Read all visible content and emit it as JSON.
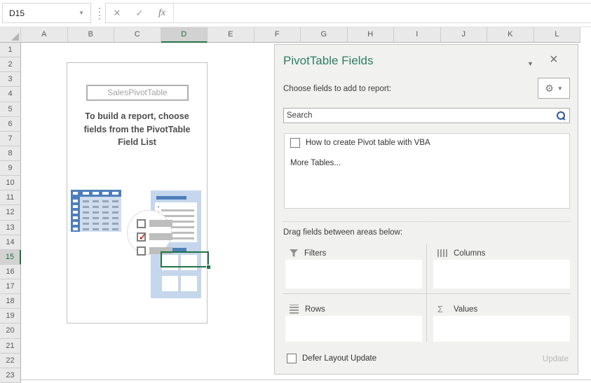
{
  "app": {
    "name_box": "D15",
    "fx_label": "fx"
  },
  "grid": {
    "columns": [
      "A",
      "B",
      "C",
      "D",
      "E",
      "F",
      "G",
      "H",
      "I",
      "J",
      "K",
      "L"
    ],
    "row_count": 23,
    "selected_column": "D",
    "selected_row": 15
  },
  "placeholder": {
    "pivot_name": "SalesPivotTable",
    "message": "To build a report, choose fields from the PivotTable Field List"
  },
  "pane": {
    "title": "PivotTable Fields",
    "subtitle": "Choose fields to add to report:",
    "search": {
      "placeholder": "Search"
    },
    "fields": [
      {
        "label": "How to create Pivot table with VBA",
        "checked": false
      }
    ],
    "more_tables": "More Tables...",
    "drag_hint": "Drag fields between areas below:",
    "areas": [
      {
        "label": "Filters",
        "icon": "funnel-icon"
      },
      {
        "label": "Columns",
        "icon": "columns-icon"
      },
      {
        "label": "Rows",
        "icon": "rows-icon"
      },
      {
        "label": "Values",
        "icon": "sigma-icon"
      }
    ],
    "defer_label": "Defer Layout Update",
    "defer_checked": false,
    "update_label": "Update",
    "update_enabled": false
  },
  "colors": {
    "accent_green": "#217346",
    "title_green": "#2f7d64",
    "icon_blue": "#4e7fba",
    "icon_body_blue": "#cfddef",
    "icon_dash_blue": "#97a5ba",
    "panel_blue": "#c6d6ec",
    "check_red": "#c0392b",
    "search_blue": "#2b579a"
  }
}
